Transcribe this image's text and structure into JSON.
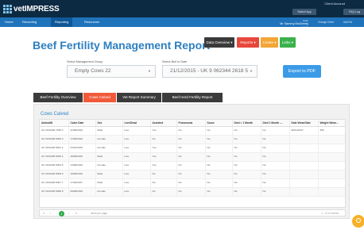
{
  "header": {
    "logo_text": "vetIMPRESS",
    "account_label": "Client Account",
    "top_buttons": [
      "Switch App",
      "FAQ Log"
    ]
  },
  "nav": {
    "items": [
      "Home",
      "Recording",
      "Reporting",
      "Resources"
    ],
    "active": "Reporting",
    "user_greeting": "Hello",
    "user_name": "Mr Sammy McGreety",
    "user_sub": "Logout",
    "right_links": [
      "Change Client",
      "Add Ext"
    ]
  },
  "page": {
    "title": "Beef Fertility Management Report"
  },
  "actions": {
    "items": [
      {
        "label": "Data Overview ▾",
        "color": "#3a3a3a"
      },
      {
        "label": "Reports ▾",
        "color": "#e8473b"
      },
      {
        "label": "Create ▾",
        "color": "#f3a536"
      },
      {
        "label": "Links ▾",
        "color": "#3ab24b"
      }
    ]
  },
  "filters": {
    "group_label": "Select Management Group",
    "group_value": "Empty Cows 22",
    "date_label": "Select Bull In Date",
    "date_value": "21/12/2015 - UK 9 062344 2618 5",
    "export_label": "Export to PDF"
  },
  "tabs": [
    "Beef Fertility Overview",
    "Cows Calved",
    "Vet Report Summary",
    "Beef Herd Fertility Report"
  ],
  "active_tab": "Cows Calved",
  "grid": {
    "title": "Cows Calved",
    "columns": [
      "AnimalID",
      "Calve Date",
      "Sex",
      "Live/Dead",
      "Assisted",
      "Pneumonia",
      "Scour",
      "Died < 1 Month",
      "Died 1 Month -...",
      "Date Wean/Sale",
      "Weight Wean..."
    ],
    "rows": [
      [
        "UK 3164436 7035 3",
        "22/08/2016",
        "Male",
        "Live",
        "Yes",
        "No",
        "No",
        "No",
        "No",
        "08/11/2017",
        "300"
      ],
      [
        "UK 3164436 5069 3",
        "17/08/2016",
        "Female",
        "Live",
        "No",
        "No",
        "No",
        "No",
        "No",
        "",
        ""
      ],
      [
        "UK 3164436 5001 1",
        "01/10/2016",
        "Female",
        "Live",
        "Yes",
        "No",
        "No",
        "No",
        "No",
        "",
        ""
      ],
      [
        "UK 3164436 5006 4",
        "20/08/2016",
        "Male",
        "Live",
        "Yes",
        "No",
        "No",
        "No",
        "No",
        "",
        ""
      ],
      [
        "UK 3164436 5004 5",
        "14/08/2016",
        "Female",
        "Live",
        "Yes",
        "No",
        "No",
        "No",
        "No",
        "",
        ""
      ],
      [
        "UK 3164436 5009 6",
        "16/08/2016",
        "Male",
        "Live",
        "No",
        "No",
        "No",
        "No",
        "No",
        "",
        ""
      ],
      [
        "UK 3164436 5007 7",
        "17/03/2017",
        "Male",
        "Live",
        "No",
        "No",
        "No",
        "No",
        "No",
        "",
        ""
      ],
      [
        "UK 3164436 5008 9",
        "09/08/2016",
        "Female",
        "Live",
        "No",
        "No",
        "No",
        "No",
        "No",
        "",
        ""
      ]
    ]
  },
  "pager": {
    "first": "«",
    "prev": "‹",
    "current": "1",
    "next": "›",
    "last": "»",
    "items_per_page": "items per page",
    "count": "1 - 8 of 8 items"
  }
}
